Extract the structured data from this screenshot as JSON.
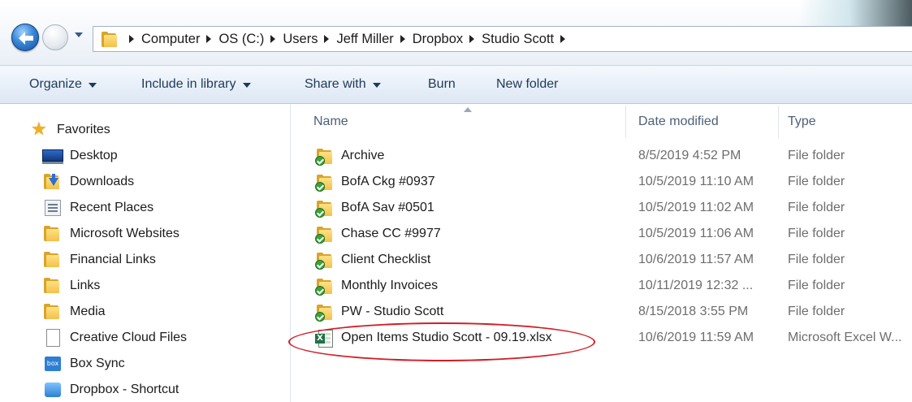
{
  "address_bar": {
    "crumbs": [
      "Computer",
      "OS (C:)",
      "Users",
      "Jeff Miller",
      "Dropbox",
      "Studio Scott"
    ]
  },
  "toolbar": {
    "organize": "Organize",
    "include_in_library": "Include in library",
    "share_with": "Share with",
    "burn": "Burn",
    "new_folder": "New folder"
  },
  "nav_pane": {
    "favorites_label": "Favorites",
    "items": [
      {
        "label": "Desktop",
        "icon": "desktop-icon"
      },
      {
        "label": "Downloads",
        "icon": "downloads-icon"
      },
      {
        "label": "Recent Places",
        "icon": "recent-places-icon"
      },
      {
        "label": "Microsoft Websites",
        "icon": "folder-icon"
      },
      {
        "label": "Financial Links",
        "icon": "folder-icon"
      },
      {
        "label": "Links",
        "icon": "folder-icon"
      },
      {
        "label": "Media",
        "icon": "folder-icon"
      },
      {
        "label": "Creative Cloud Files",
        "icon": "blank-page-icon"
      },
      {
        "label": "Box Sync",
        "icon": "box-icon"
      },
      {
        "label": "Dropbox - Shortcut",
        "icon": "dropbox-icon"
      }
    ]
  },
  "file_list": {
    "columns": {
      "name": "Name",
      "date_modified": "Date modified",
      "type": "Type"
    },
    "rows": [
      {
        "name": "Archive",
        "date": "8/5/2019 4:52 PM",
        "type": "File folder",
        "icon": "synced-folder-icon"
      },
      {
        "name": "BofA Ckg #0937",
        "date": "10/5/2019 11:10 AM",
        "type": "File folder",
        "icon": "synced-folder-icon"
      },
      {
        "name": "BofA Sav #0501",
        "date": "10/5/2019 11:02 AM",
        "type": "File folder",
        "icon": "synced-folder-icon"
      },
      {
        "name": "Chase CC #9977",
        "date": "10/5/2019 11:06 AM",
        "type": "File folder",
        "icon": "synced-folder-icon"
      },
      {
        "name": "Client Checklist",
        "date": "10/6/2019 11:57 AM",
        "type": "File folder",
        "icon": "synced-folder-icon"
      },
      {
        "name": "Monthly Invoices",
        "date": "10/11/2019 12:32 ...",
        "type": "File folder",
        "icon": "synced-folder-icon"
      },
      {
        "name": "PW - Studio Scott",
        "date": "8/15/2018 3:55 PM",
        "type": "File folder",
        "icon": "synced-folder-icon"
      },
      {
        "name": "Open Items Studio Scott - 09.19.xlsx",
        "date": "10/6/2019 11:59 AM",
        "type": "Microsoft Excel W...",
        "icon": "excel-file-icon"
      }
    ]
  },
  "colors": {
    "highlight": "#d21d25",
    "toolbar_text": "#1e395b",
    "header_text": "#4c607a"
  }
}
